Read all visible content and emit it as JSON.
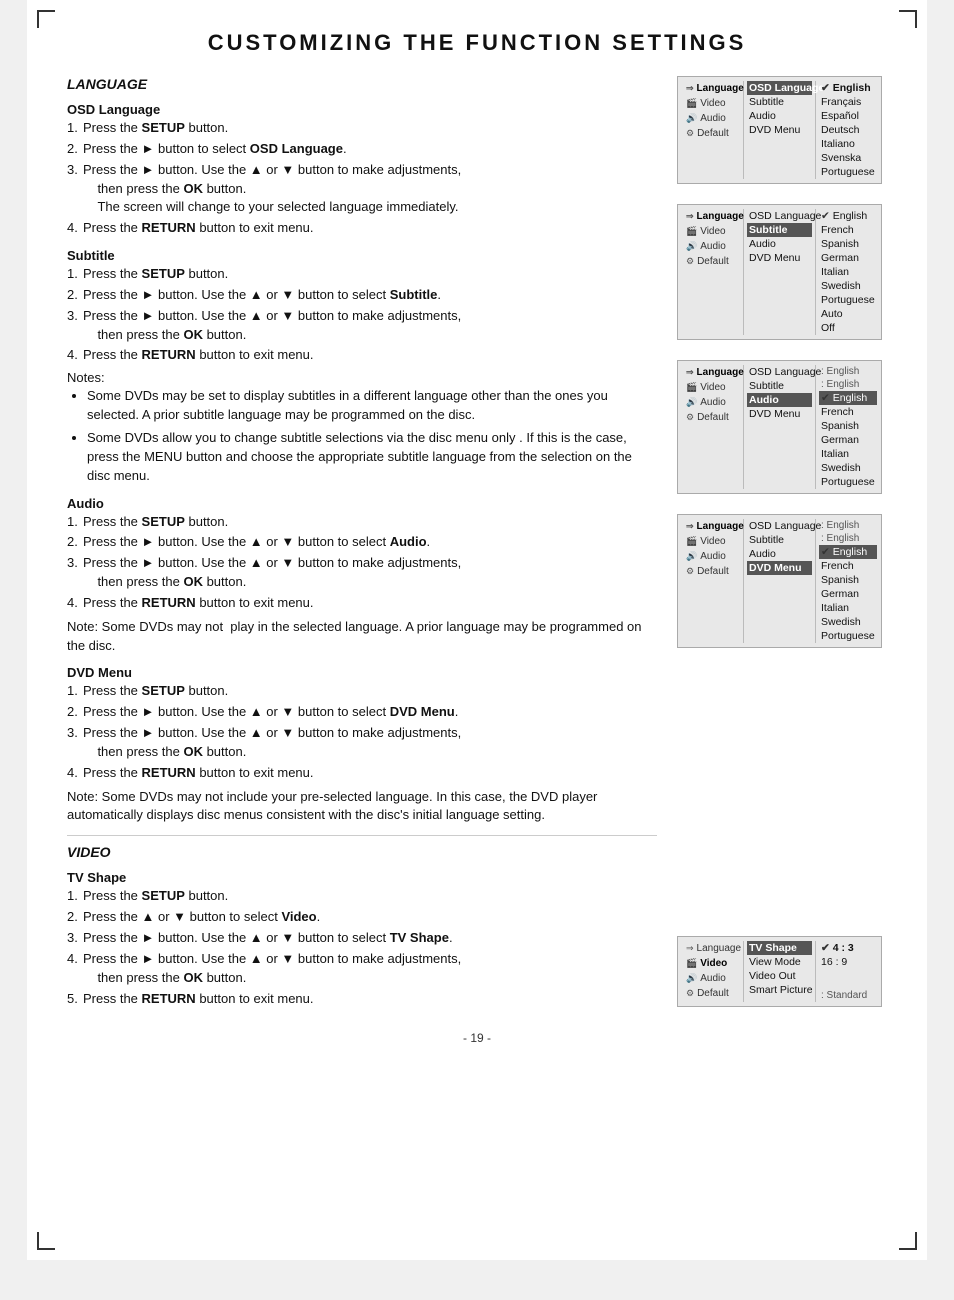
{
  "page": {
    "title": "CUSTOMIZING THE  FUNCTION  SETTINGS",
    "page_number": "- 19 -"
  },
  "language_section": {
    "title": "LANGUAGE",
    "osd_subtitle": "OSD  Language",
    "osd_steps": [
      {
        "num": "1.",
        "text": "Press the ",
        "bold": "SETUP",
        "rest": " button."
      },
      {
        "num": "2.",
        "text": "Press the ► button to select ",
        "bold": "OSD Language",
        "rest": "."
      },
      {
        "num": "3.",
        "text": "Press the ► button. Use the ▲ or ▼ button to make adjustments,\n    then press the ",
        "bold": "OK",
        "rest": " button.\n    The screen will change to your selected language immediately."
      },
      {
        "num": "4.",
        "text": "Press the ",
        "bold": "RETURN",
        "rest": " button to exit menu."
      }
    ],
    "subtitle_title": "Subtitle",
    "subtitle_steps": [
      {
        "num": "1.",
        "text": "Press the ",
        "bold": "SETUP",
        "rest": " button."
      },
      {
        "num": "2.",
        "text": "Press the ► button. Use the ▲ or ▼ button to select ",
        "bold": "Subtitle",
        "rest": "."
      },
      {
        "num": "3.",
        "text": "Press the ► button. Use the ▲ or ▼ button to make adjustments,\n    then press the ",
        "bold": "OK",
        "rest": " button."
      },
      {
        "num": "4.",
        "text": "Press the ",
        "bold": "RETURN",
        "rest": " button to exit menu."
      }
    ],
    "subtitle_notes_label": "Notes:",
    "subtitle_notes": [
      "Some DVDs may be set to display subtitles in a different language other than the ones you selected. A prior subtitle language may be programmed on the disc.",
      "Some DVDs allow you to change subtitle selections via the disc menu only . If this is the case, press the MENU button and choose the appropriate subtitle language from the selection on the disc menu."
    ],
    "audio_title": "Audio",
    "audio_steps": [
      {
        "num": "1.",
        "text": "Press the ",
        "bold": "SETUP",
        "rest": " button."
      },
      {
        "num": "2.",
        "text": "Press the ► button. Use the ▲ or ▼ button to select ",
        "bold": "Audio",
        "rest": "."
      },
      {
        "num": "3.",
        "text": "Press the ► button. Use the ▲ or ▼ button to make adjustments,\n    then press the ",
        "bold": "OK",
        "rest": " button."
      },
      {
        "num": "4.",
        "text": "Press the ",
        "bold": "RETURN",
        "rest": " button to exit menu."
      }
    ],
    "audio_note": "Note: Some DVDs may not  play in the selected language. A prior language may be programmed on the disc.",
    "dvdmenu_title": "DVD Menu",
    "dvdmenu_steps": [
      {
        "num": "1.",
        "text": "Press the ",
        "bold": "SETUP",
        "rest": " button."
      },
      {
        "num": "2.",
        "text": "Press the ► button. Use the ▲ or ▼ button to select ",
        "bold": "DVD Menu",
        "rest": "."
      },
      {
        "num": "3.",
        "text": "Press the ► button. Use the ▲ or ▼ button to make adjustments,\n    then press the ",
        "bold": "OK",
        "rest": " button."
      },
      {
        "num": "4.",
        "text": "Press the ",
        "bold": "RETURN",
        "rest": " button to exit menu."
      }
    ],
    "dvdmenu_note": "Note: Some DVDs may not include your pre-selected language. In this case, the DVD player automatically displays disc menus consistent with the disc's initial language setting."
  },
  "video_section": {
    "title": "VIDEO",
    "tvshape_title": "TV  Shape",
    "tvshape_steps": [
      {
        "num": "1.",
        "text": "Press the ",
        "bold": "SETUP",
        "rest": " button."
      },
      {
        "num": "2.",
        "text": "Press the ▲ or ▼ button to select ",
        "bold": "Video",
        "rest": "."
      },
      {
        "num": "3.",
        "text": "Press the ► button. Use the ▲ or ▼ button to select ",
        "bold": "TV Shape",
        "rest": "."
      },
      {
        "num": "4.",
        "text": "Press the ► button. Use the ▲ or ▼ button to make adjustments,\n    then press the ",
        "bold": "OK",
        "rest": " button."
      },
      {
        "num": "5.",
        "text": "Press the ",
        "bold": "RETURN",
        "rest": " button to exit menu."
      }
    ]
  },
  "menus": {
    "osd_menu": {
      "sidebar": [
        {
          "icon": "⇐",
          "label": "Language",
          "active": true
        },
        {
          "icon": "🎬",
          "label": "Video"
        },
        {
          "icon": "🔊",
          "label": "Audio"
        },
        {
          "icon": "⚙",
          "label": "Default"
        }
      ],
      "center_items": [
        {
          "label": "OSD Language",
          "selected": true
        },
        {
          "label": "Subtitle"
        },
        {
          "label": "Audio"
        },
        {
          "label": "DVD Menu"
        }
      ],
      "right_items": [
        {
          "label": "English",
          "check": true,
          "selected": true
        },
        {
          "label": "Français"
        },
        {
          "label": "Español"
        },
        {
          "label": "Deutsch"
        },
        {
          "label": "Italiano"
        },
        {
          "label": "Svenska"
        },
        {
          "label": "Portuguese"
        }
      ]
    },
    "subtitle_menu": {
      "sidebar": [
        {
          "icon": "⇐",
          "label": "Language",
          "active": true
        },
        {
          "icon": "🎬",
          "label": "Video"
        },
        {
          "icon": "🔊",
          "label": "Audio"
        },
        {
          "icon": "⚙",
          "label": "Default"
        }
      ],
      "center_items": [
        {
          "label": "OSD Language"
        },
        {
          "label": "Subtitle",
          "selected": true
        },
        {
          "label": "Audio"
        },
        {
          "label": "DVD Menu"
        }
      ],
      "right_items": [
        {
          "label": "English",
          "check": true
        },
        {
          "label": "French"
        },
        {
          "label": "Spanish"
        },
        {
          "label": "German"
        },
        {
          "label": "Italian"
        },
        {
          "label": "Swedish"
        },
        {
          "label": "Portuguese"
        },
        {
          "label": "Auto"
        },
        {
          "label": "Off"
        }
      ]
    },
    "audio_menu": {
      "sidebar": [
        {
          "icon": "⇐",
          "label": "Language",
          "active": true
        },
        {
          "icon": "🎬",
          "label": "Video"
        },
        {
          "icon": "🔊",
          "label": "Audio"
        },
        {
          "icon": "⚙",
          "label": "Default"
        }
      ],
      "center_items": [
        {
          "label": "OSD Language"
        },
        {
          "label": "Subtitle"
        },
        {
          "label": "Audio",
          "selected": true
        },
        {
          "label": "DVD Menu"
        }
      ],
      "right_items_top": [
        {
          "label": ": English"
        },
        {
          "label": ": English"
        }
      ],
      "right_items": [
        {
          "label": "English",
          "check": true,
          "selected": true
        },
        {
          "label": "French"
        },
        {
          "label": "Spanish"
        },
        {
          "label": "German"
        },
        {
          "label": "Italian"
        },
        {
          "label": "Swedish"
        },
        {
          "label": "Portuguese"
        }
      ]
    },
    "dvdmenu_menu": {
      "sidebar": [
        {
          "icon": "⇐",
          "label": "Language",
          "active": true
        },
        {
          "icon": "🎬",
          "label": "Video"
        },
        {
          "icon": "🔊",
          "label": "Audio"
        },
        {
          "icon": "⚙",
          "label": "Default"
        }
      ],
      "center_items": [
        {
          "label": "OSD Language"
        },
        {
          "label": "Subtitle"
        },
        {
          "label": "Audio"
        },
        {
          "label": "DVD Menu",
          "selected": true
        }
      ],
      "right_items_top": [
        {
          "label": ": English"
        },
        {
          "label": ": English"
        }
      ],
      "right_items": [
        {
          "label": "English",
          "check": true,
          "selected": true
        },
        {
          "label": "French"
        },
        {
          "label": "Spanish"
        },
        {
          "label": "German"
        },
        {
          "label": "Italian"
        },
        {
          "label": "Swedish"
        },
        {
          "label": "Portuguese"
        }
      ]
    },
    "video_menu": {
      "sidebar": [
        {
          "icon": "⇐",
          "label": "Language"
        },
        {
          "icon": "🎬",
          "label": "Video",
          "active": true
        },
        {
          "icon": "🔊",
          "label": "Audio"
        },
        {
          "icon": "⚙",
          "label": "Default"
        }
      ],
      "center_items": [
        {
          "label": "TV Shape",
          "selected": true
        },
        {
          "label": "View Mode"
        },
        {
          "label": "Video Out"
        },
        {
          "label": "Smart Picture"
        }
      ],
      "right_items": [
        {
          "label": "4 : 3",
          "check": true,
          "selected": true
        },
        {
          "label": "16 : 9"
        }
      ],
      "right_items_bottom": [
        {
          "label": ": Standard"
        }
      ]
    }
  }
}
